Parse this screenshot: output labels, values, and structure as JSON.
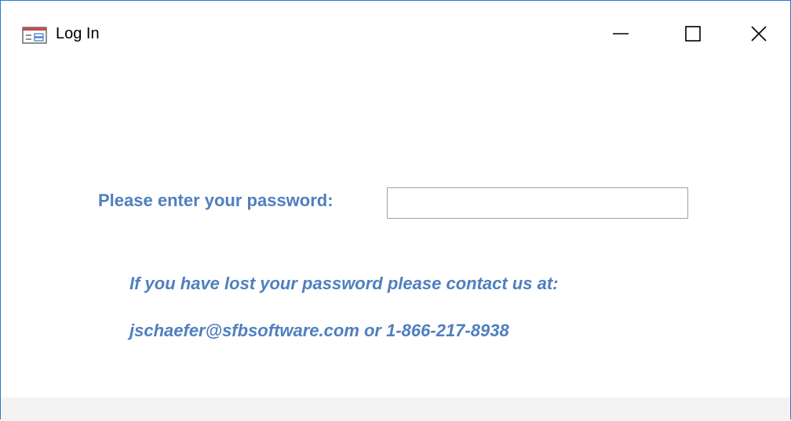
{
  "window": {
    "title": "Log In",
    "icon": "form-icon",
    "controls": {
      "minimize_icon": "minimize-icon",
      "maximize_icon": "maximize-icon",
      "close_icon": "close-icon"
    }
  },
  "form": {
    "password_label": "Please enter your password:",
    "password_value": "",
    "help_line_1": "If you have lost your password please contact us at:",
    "help_line_2": "jschaefer@sfbsoftware.com or 1-866-217-8938"
  },
  "colors": {
    "accent_text": "#4f7fbf",
    "window_border": "#2b79c9",
    "footer_background": "#f3f3f3"
  }
}
